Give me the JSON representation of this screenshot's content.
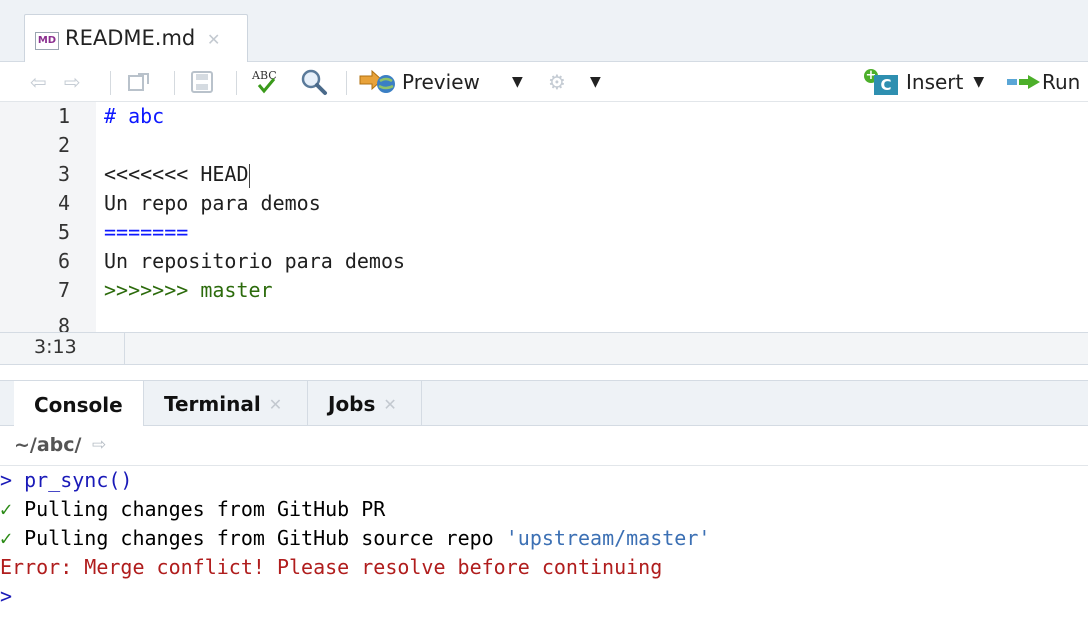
{
  "editor": {
    "file_tab": {
      "icon_text": "MD",
      "label": "README.md",
      "close_icon": "close-icon"
    },
    "toolbar": {
      "preview_label": "Preview",
      "insert_label": "Insert",
      "run_label": "Run"
    },
    "lines": [
      {
        "num": "1",
        "text": "# abc"
      },
      {
        "num": "2",
        "text": ""
      },
      {
        "num": "3",
        "text": "<<<<<<< HEAD"
      },
      {
        "num": "4",
        "text": "Un repo para demos"
      },
      {
        "num": "5",
        "text": "======="
      },
      {
        "num": "6",
        "text": "Un repositorio para demos"
      },
      {
        "num": "7",
        "text": ">>>>>>> master"
      },
      {
        "num": "8",
        "text": ""
      }
    ],
    "cursor_position": "3:13"
  },
  "console": {
    "tabs": [
      {
        "label": "Console"
      },
      {
        "label": "Terminal"
      },
      {
        "label": "Jobs"
      }
    ],
    "path": "~/abc/",
    "output": {
      "l1_prompt": "> ",
      "l1_cmd": "pr_sync()",
      "l2_check": "✓",
      "l2_text": " Pulling changes from GitHub PR",
      "l3_check": "✓",
      "l3_text": " Pulling changes from GitHub source repo ",
      "l3_string": "'upstream/master'",
      "l4_text": "Error: Merge conflict! Please resolve before continuing",
      "l5_prompt": ">"
    }
  },
  "colors": {
    "heading_blue": "#0d18ff",
    "merge_green": "#2c6b0c",
    "error_red": "#b01d1d",
    "prompt_blue": "#1a1ab8"
  }
}
